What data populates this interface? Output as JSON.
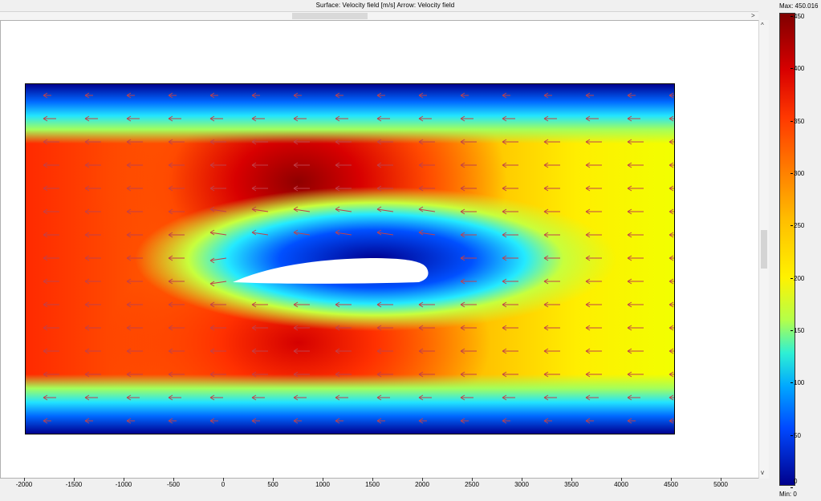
{
  "header": {
    "title": "Surface: Velocity field [m/s]   Arrow: Velocity field"
  },
  "scroll": {
    "h_right_arrow": ">",
    "v_up_arrow": "^",
    "v_down_arrow": "v"
  },
  "axis": {
    "x_ticks": [
      "-2000",
      "-1500",
      "-1000",
      "-500",
      "0",
      "500",
      "1000",
      "1500",
      "2000",
      "2500",
      "3000",
      "3500",
      "4000",
      "4500",
      "5000"
    ]
  },
  "colorbar": {
    "max_label": "Max: 450.016",
    "min_label": "Min: 0",
    "ticks": [
      "450",
      "400",
      "350",
      "300",
      "250",
      "200",
      "150",
      "100",
      "50",
      "0"
    ],
    "colors": [
      "#800000",
      "#d80000",
      "#ff3800",
      "#ff7c00",
      "#ffbf00",
      "#fff200",
      "#b4ff4a",
      "#2ef0d4",
      "#00a8ff",
      "#0048ff",
      "#00008c"
    ]
  },
  "plot": {
    "arrow_color": "#c0404a",
    "arrow_direction": "left",
    "airfoil_color": "#ffffff"
  }
}
